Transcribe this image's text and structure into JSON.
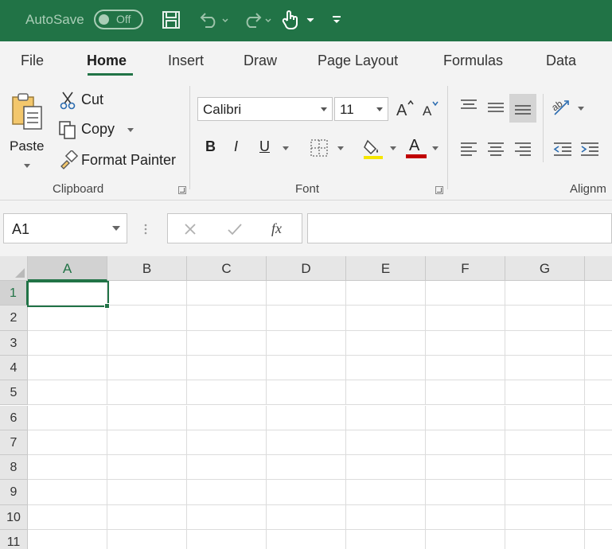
{
  "titlebar": {
    "autosave_label": "AutoSave",
    "autosave_state": "Off",
    "icons": [
      "save-icon",
      "undo-icon",
      "redo-icon",
      "touch-mode-icon",
      "customize-qat-icon"
    ],
    "accent_color": "#217346"
  },
  "tabs": [
    "File",
    "Home",
    "Insert",
    "Draw",
    "Page Layout",
    "Formulas",
    "Data"
  ],
  "active_tab": "Home",
  "clipboard": {
    "paste_label": "Paste",
    "cut_label": "Cut",
    "copy_label": "Copy",
    "format_painter_label": "Format Painter",
    "group_label": "Clipboard"
  },
  "font": {
    "font_name": "Calibri",
    "font_size": "11",
    "bold": "B",
    "italic": "I",
    "underline": "U",
    "font_color_glyph": "A",
    "highlight_color": "#f5e600",
    "font_color": "#c00000",
    "group_label": "Font"
  },
  "alignment": {
    "group_label": "Alignm"
  },
  "formula_bar": {
    "name_box": "A1",
    "fx": "fx",
    "formula_value": ""
  },
  "grid": {
    "columns": [
      "A",
      "B",
      "C",
      "D",
      "E",
      "F",
      "G"
    ],
    "rows": [
      "1",
      "2",
      "3",
      "4",
      "5",
      "6",
      "7",
      "8",
      "9",
      "10",
      "11"
    ],
    "selected_cell": "A1"
  }
}
